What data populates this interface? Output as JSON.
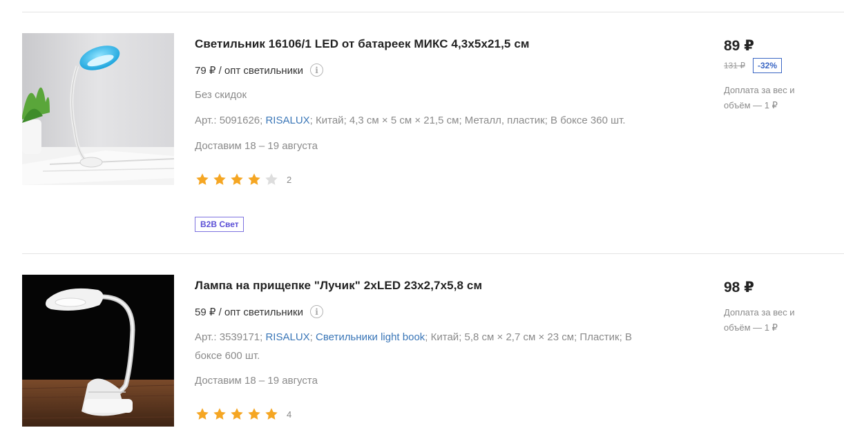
{
  "products": [
    {
      "title": "Светильник 16106/1 LED от батареек МИКС 4,3х5х21,5 см",
      "wholesale": "79 ₽ / опт светильники",
      "no_discount": "Без скидок",
      "attrs": [
        {
          "text": "Арт.: 5091626",
          "link": false
        },
        {
          "text": "RISALUX",
          "link": true
        },
        {
          "text": "Китай",
          "link": false
        },
        {
          "text": "4,3 см × 5 см × 21,5 см",
          "link": false
        },
        {
          "text": "Металл, пластик",
          "link": false
        },
        {
          "text": "В боксе 360 шт.",
          "link": false
        }
      ],
      "delivery": "Доставим 18 – 19 августа",
      "rating": 4,
      "reviews": "2",
      "badge": "B2B Свет",
      "price": "89 ₽",
      "old_price": "131 ₽",
      "discount": "-32%",
      "surcharge": "Доплата за вес и объём — 1 ₽"
    },
    {
      "title": "Лампа на прищепке \"Лучик\" 2хLED 23х2,7х5,8 см",
      "wholesale": "59 ₽ / опт светильники",
      "attrs": [
        {
          "text": "Арт.: 3539171",
          "link": false
        },
        {
          "text": "RISALUX",
          "link": true
        },
        {
          "text": "Светильники light book",
          "link": true
        },
        {
          "text": "Китай",
          "link": false
        },
        {
          "text": "5,8 см × 2,7 см × 23 см",
          "link": false
        },
        {
          "text": "Пластик",
          "link": false
        },
        {
          "text": "В боксе 600 шт.",
          "link": false
        }
      ],
      "delivery": "Доставим 18 – 19 августа",
      "rating": 5,
      "reviews": "4",
      "price": "98 ₽",
      "surcharge": "Доплата за вес и объём — 1 ₽"
    }
  ],
  "colors": {
    "star_filled": "#f5a623",
    "star_empty": "#dddddd",
    "link": "#3a76b7",
    "badge": "#5b4fd6",
    "discount": "#3a66c4"
  }
}
